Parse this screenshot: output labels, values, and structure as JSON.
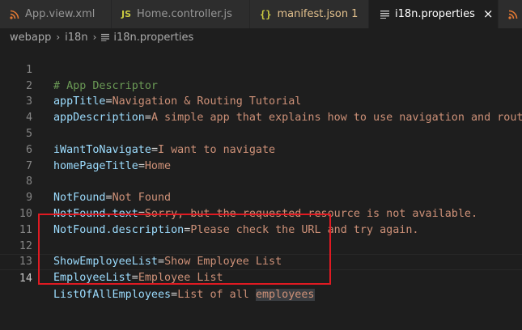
{
  "tabs": [
    {
      "label": "App.view.xml",
      "icon": "xml-rss-icon",
      "count": ""
    },
    {
      "label": "Home.controller.js",
      "icon": "js-icon",
      "count": ""
    },
    {
      "label": "manifest.json",
      "icon": "json-braces-icon",
      "count": "1"
    },
    {
      "label": "i18n.properties",
      "icon": "properties-lines-icon",
      "count": ""
    }
  ],
  "js_icon_text": "JS",
  "json_icon_text": "{}",
  "close_glyph": "×",
  "breadcrumb": {
    "items": [
      "webapp",
      "i18n",
      "i18n.properties"
    ]
  },
  "editor": {
    "lines": [
      {
        "num": "1",
        "comment": "# App Descriptor",
        "key": "",
        "eq": "",
        "value": ""
      },
      {
        "num": "2",
        "comment": "",
        "key": "appTitle",
        "eq": "=",
        "value": "Navigation & Routing Tutorial"
      },
      {
        "num": "3",
        "comment": "",
        "key": "appDescription",
        "eq": "=",
        "value": "A simple app that explains how to use navigation and routi"
      },
      {
        "num": "4",
        "comment": "",
        "key": "",
        "eq": "",
        "value": ""
      },
      {
        "num": "5",
        "comment": "",
        "key": "iWantToNavigate",
        "eq": "=",
        "value": "I want to navigate"
      },
      {
        "num": "6",
        "comment": "",
        "key": "homePageTitle",
        "eq": "=",
        "value": "Home"
      },
      {
        "num": "7",
        "comment": "",
        "key": "",
        "eq": "",
        "value": ""
      },
      {
        "num": "8",
        "comment": "",
        "key": "NotFound",
        "eq": "=",
        "value": "Not Found"
      },
      {
        "num": "9",
        "comment": "",
        "key": "NotFound.text",
        "eq": "=",
        "value": "Sorry, but the requested resource is not available."
      },
      {
        "num": "10",
        "comment": "",
        "key": "NotFound.description",
        "eq": "=",
        "value": "Please check the URL and try again."
      },
      {
        "num": "11",
        "comment": "",
        "key": "",
        "eq": "",
        "value": ""
      },
      {
        "num": "12",
        "comment": "",
        "key": "ShowEmployeeList",
        "eq": "=",
        "value": "Show Employee List"
      },
      {
        "num": "13",
        "comment": "",
        "key": "EmployeeList",
        "eq": "=",
        "value": "Employee List"
      },
      {
        "num": "14",
        "comment": "",
        "key": "ListOfAllEmployees",
        "eq": "=",
        "value": "List of all ",
        "selected": "employees"
      }
    ]
  },
  "colors": {
    "editor_bg": "#1e1e1e",
    "comment": "#6a9955",
    "key": "#9cdcfe",
    "value": "#ce9178",
    "annotation_box": "#e01a22",
    "modified_tab": "#e2c08d"
  }
}
